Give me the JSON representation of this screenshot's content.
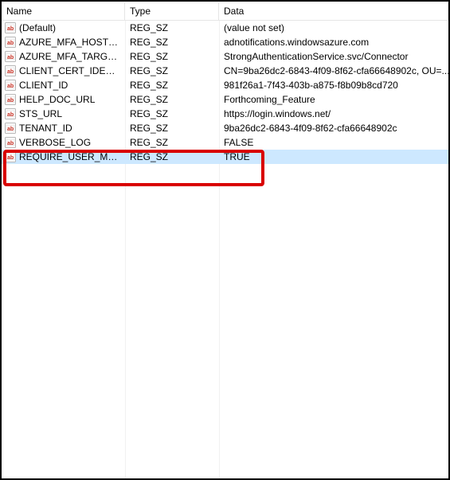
{
  "columns": {
    "name": "Name",
    "type": "Type",
    "data": "Data"
  },
  "rows": [
    {
      "name": "(Default)",
      "type": "REG_SZ",
      "data": "(value not set)",
      "selected": false
    },
    {
      "name": "AZURE_MFA_HOSTN...",
      "type": "REG_SZ",
      "data": "adnotifications.windowsazure.com",
      "selected": false
    },
    {
      "name": "AZURE_MFA_TARGET...",
      "type": "REG_SZ",
      "data": "StrongAuthenticationService.svc/Connector",
      "selected": false
    },
    {
      "name": "CLIENT_CERT_IDENTI...",
      "type": "REG_SZ",
      "data": "CN=9ba26dc2-6843-4f09-8f62-cfa66648902c, OU=...",
      "selected": false
    },
    {
      "name": "CLIENT_ID",
      "type": "REG_SZ",
      "data": "981f26a1-7f43-403b-a875-f8b09b8cd720",
      "selected": false
    },
    {
      "name": "HELP_DOC_URL",
      "type": "REG_SZ",
      "data": "Forthcoming_Feature",
      "selected": false
    },
    {
      "name": "STS_URL",
      "type": "REG_SZ",
      "data": "https://login.windows.net/",
      "selected": false
    },
    {
      "name": "TENANT_ID",
      "type": "REG_SZ",
      "data": "9ba26dc2-6843-4f09-8f62-cfa66648902c",
      "selected": false
    },
    {
      "name": "VERBOSE_LOG",
      "type": "REG_SZ",
      "data": "FALSE",
      "selected": false
    },
    {
      "name": "REQUIRE_USER_MATCH",
      "type": "REG_SZ",
      "data": "TRUE",
      "selected": true
    }
  ]
}
